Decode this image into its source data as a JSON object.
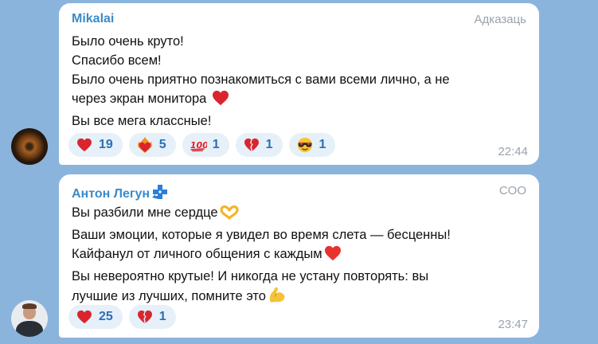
{
  "messages": [
    {
      "sender": "Mikalai",
      "tag": "Адказаць",
      "lines": [
        "Было очень круто!",
        "Спасибо всем!",
        "Было очень приятно познакомиться с вами всеми лично, а не",
        "через экран монитора",
        "Вы все мега классные!"
      ],
      "reactions": [
        {
          "icon": "red-heart-icon",
          "count": "19"
        },
        {
          "icon": "heart-on-fire-icon",
          "count": "5"
        },
        {
          "icon": "hundred-points-icon",
          "count": "1"
        },
        {
          "icon": "broken-heart-icon",
          "count": "1"
        },
        {
          "icon": "heart-eyes-sunglasses-icon",
          "count": "1"
        }
      ],
      "time": "22:44"
    },
    {
      "sender": "Антон Легун",
      "tag": "COO",
      "lines": [
        "Вы разбили мне сердце",
        "Ваши эмоции, которые я увидел во время слета — бесценны!",
        "Кайфанул от личного общения с каждым",
        "Вы невероятно крутые! И никогда не устану повторять: вы",
        "лучшие из лучших, помните это"
      ],
      "reactions": [
        {
          "icon": "red-heart-icon",
          "count": "25"
        },
        {
          "icon": "broken-heart-icon",
          "count": "1"
        }
      ],
      "time": "23:47"
    }
  ],
  "colors": {
    "background": "#8bb4dd",
    "sender": "#3a8bc9",
    "reaction_chip": "#e6f0f9",
    "reaction_count": "#2b6fb3"
  }
}
